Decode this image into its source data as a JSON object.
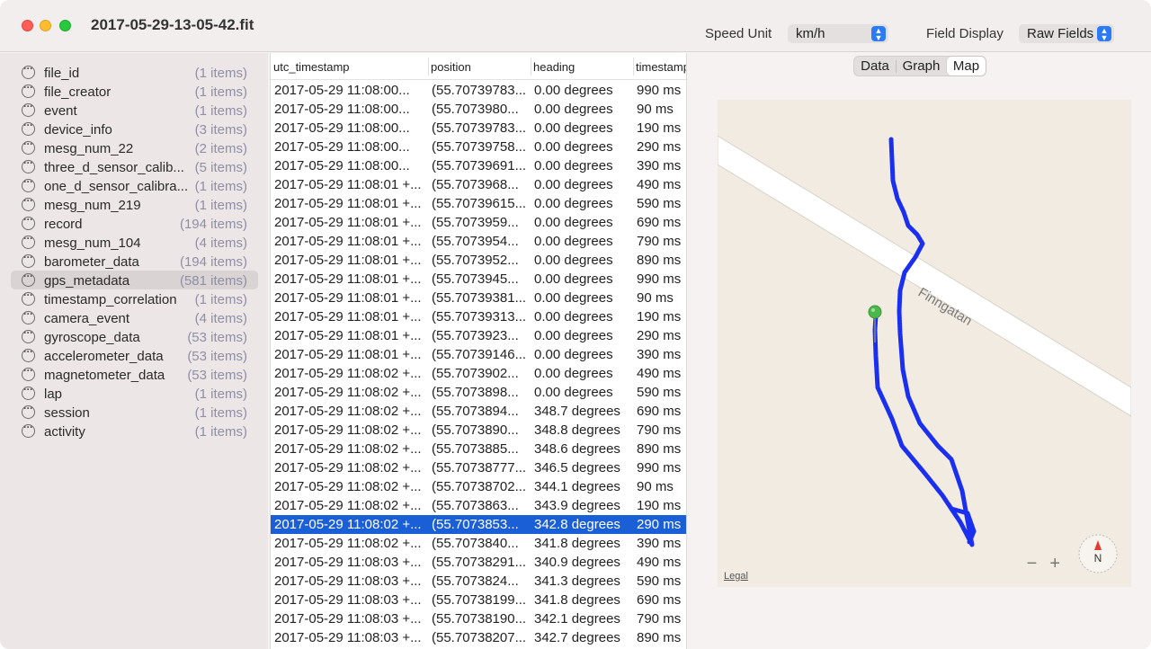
{
  "window": {
    "title": "2017-05-29-13-05-42.fit"
  },
  "toolbar": {
    "speed_unit_label": "Speed Unit",
    "speed_unit_value": "km/h",
    "field_display_label": "Field Display",
    "field_display_value": "Raw Fields"
  },
  "sidebar": {
    "items": [
      {
        "name": "file_id",
        "count": "(1 items)"
      },
      {
        "name": "file_creator",
        "count": "(1 items)"
      },
      {
        "name": "event",
        "count": "(1 items)"
      },
      {
        "name": "device_info",
        "count": "(3 items)"
      },
      {
        "name": "mesg_num_22",
        "count": "(2 items)"
      },
      {
        "name": "three_d_sensor_calib...",
        "count": "(5 items)"
      },
      {
        "name": "one_d_sensor_calibra...",
        "count": "(1 items)"
      },
      {
        "name": "mesg_num_219",
        "count": "(1 items)"
      },
      {
        "name": "record",
        "count": "(194 items)"
      },
      {
        "name": "mesg_num_104",
        "count": "(4 items)"
      },
      {
        "name": "barometer_data",
        "count": "(194 items)"
      },
      {
        "name": "gps_metadata",
        "count": "(581 items)"
      },
      {
        "name": "timestamp_correlation",
        "count": "(1 items)"
      },
      {
        "name": "camera_event",
        "count": "(4 items)"
      },
      {
        "name": "gyroscope_data",
        "count": "(53 items)"
      },
      {
        "name": "accelerometer_data",
        "count": "(53 items)"
      },
      {
        "name": "magnetometer_data",
        "count": "(53 items)"
      },
      {
        "name": "lap",
        "count": "(1 items)"
      },
      {
        "name": "session",
        "count": "(1 items)"
      },
      {
        "name": "activity",
        "count": "(1 items)"
      }
    ],
    "selected_index": 11
  },
  "table": {
    "columns": [
      "utc_timestamp",
      "position",
      "heading",
      "timestamp"
    ],
    "rows": [
      [
        "2017-05-29 11:08:00...",
        "(55.70739783...",
        "0.00 degrees",
        "990 ms"
      ],
      [
        "2017-05-29 11:08:00...",
        "(55.7073980...",
        "0.00 degrees",
        "90 ms"
      ],
      [
        "2017-05-29 11:08:00...",
        "(55.70739783...",
        "0.00 degrees",
        "190 ms"
      ],
      [
        "2017-05-29 11:08:00...",
        "(55.70739758...",
        "0.00 degrees",
        "290 ms"
      ],
      [
        "2017-05-29 11:08:00...",
        "(55.70739691...",
        "0.00 degrees",
        "390 ms"
      ],
      [
        "2017-05-29 11:08:01 +...",
        "(55.7073968...",
        "0.00 degrees",
        "490 ms"
      ],
      [
        "2017-05-29 11:08:01 +...",
        "(55.70739615...",
        "0.00 degrees",
        "590 ms"
      ],
      [
        "2017-05-29 11:08:01 +...",
        "(55.7073959...",
        "0.00 degrees",
        "690 ms"
      ],
      [
        "2017-05-29 11:08:01 +...",
        "(55.7073954...",
        "0.00 degrees",
        "790 ms"
      ],
      [
        "2017-05-29 11:08:01 +...",
        "(55.7073952...",
        "0.00 degrees",
        "890 ms"
      ],
      [
        "2017-05-29 11:08:01 +...",
        "(55.7073945...",
        "0.00 degrees",
        "990 ms"
      ],
      [
        "2017-05-29 11:08:01 +...",
        "(55.70739381...",
        "0.00 degrees",
        "90 ms"
      ],
      [
        "2017-05-29 11:08:01 +...",
        "(55.70739313...",
        "0.00 degrees",
        "190 ms"
      ],
      [
        "2017-05-29 11:08:01 +...",
        "(55.7073923...",
        "0.00 degrees",
        "290 ms"
      ],
      [
        "2017-05-29 11:08:01 +...",
        "(55.70739146...",
        "0.00 degrees",
        "390 ms"
      ],
      [
        "2017-05-29 11:08:02 +...",
        "(55.7073902...",
        "0.00 degrees",
        "490 ms"
      ],
      [
        "2017-05-29 11:08:02 +...",
        "(55.7073898...",
        "0.00 degrees",
        "590 ms"
      ],
      [
        "2017-05-29 11:08:02 +...",
        "(55.7073894...",
        "348.7 degrees",
        "690 ms"
      ],
      [
        "2017-05-29 11:08:02 +...",
        "(55.7073890...",
        "348.8 degrees",
        "790 ms"
      ],
      [
        "2017-05-29 11:08:02 +...",
        "(55.7073885...",
        "348.6 degrees",
        "890 ms"
      ],
      [
        "2017-05-29 11:08:02 +...",
        "(55.70738777...",
        "346.5 degrees",
        "990 ms"
      ],
      [
        "2017-05-29 11:08:02 +...",
        "(55.70738702...",
        "344.1 degrees",
        "90 ms"
      ],
      [
        "2017-05-29 11:08:02 +...",
        "(55.7073863...",
        "343.9 degrees",
        "190 ms"
      ],
      [
        "2017-05-29 11:08:02 +...",
        "(55.7073853...",
        "342.8 degrees",
        "290 ms"
      ],
      [
        "2017-05-29 11:08:02 +...",
        "(55.7073840...",
        "341.8 degrees",
        "390 ms"
      ],
      [
        "2017-05-29 11:08:03 +...",
        "(55.70738291...",
        "340.9 degrees",
        "490 ms"
      ],
      [
        "2017-05-29 11:08:03 +...",
        "(55.7073824...",
        "341.3 degrees",
        "590 ms"
      ],
      [
        "2017-05-29 11:08:03 +...",
        "(55.70738199...",
        "341.8 degrees",
        "690 ms"
      ],
      [
        "2017-05-29 11:08:03 +...",
        "(55.70738190...",
        "342.1 degrees",
        "790 ms"
      ],
      [
        "2017-05-29 11:08:03 +...",
        "(55.70738207...",
        "342.7 degrees",
        "890 ms"
      ]
    ],
    "selected_index": 23
  },
  "view_tabs": {
    "data": "Data",
    "graph": "Graph",
    "map": "Map",
    "active": "Map"
  },
  "map": {
    "street_name": "Finngatan",
    "legal": "Legal",
    "zoom_out": "−",
    "zoom_in": "+",
    "compass_label": "N",
    "route_color": "#1a2ff0",
    "pin_color": "#4cb84c"
  }
}
